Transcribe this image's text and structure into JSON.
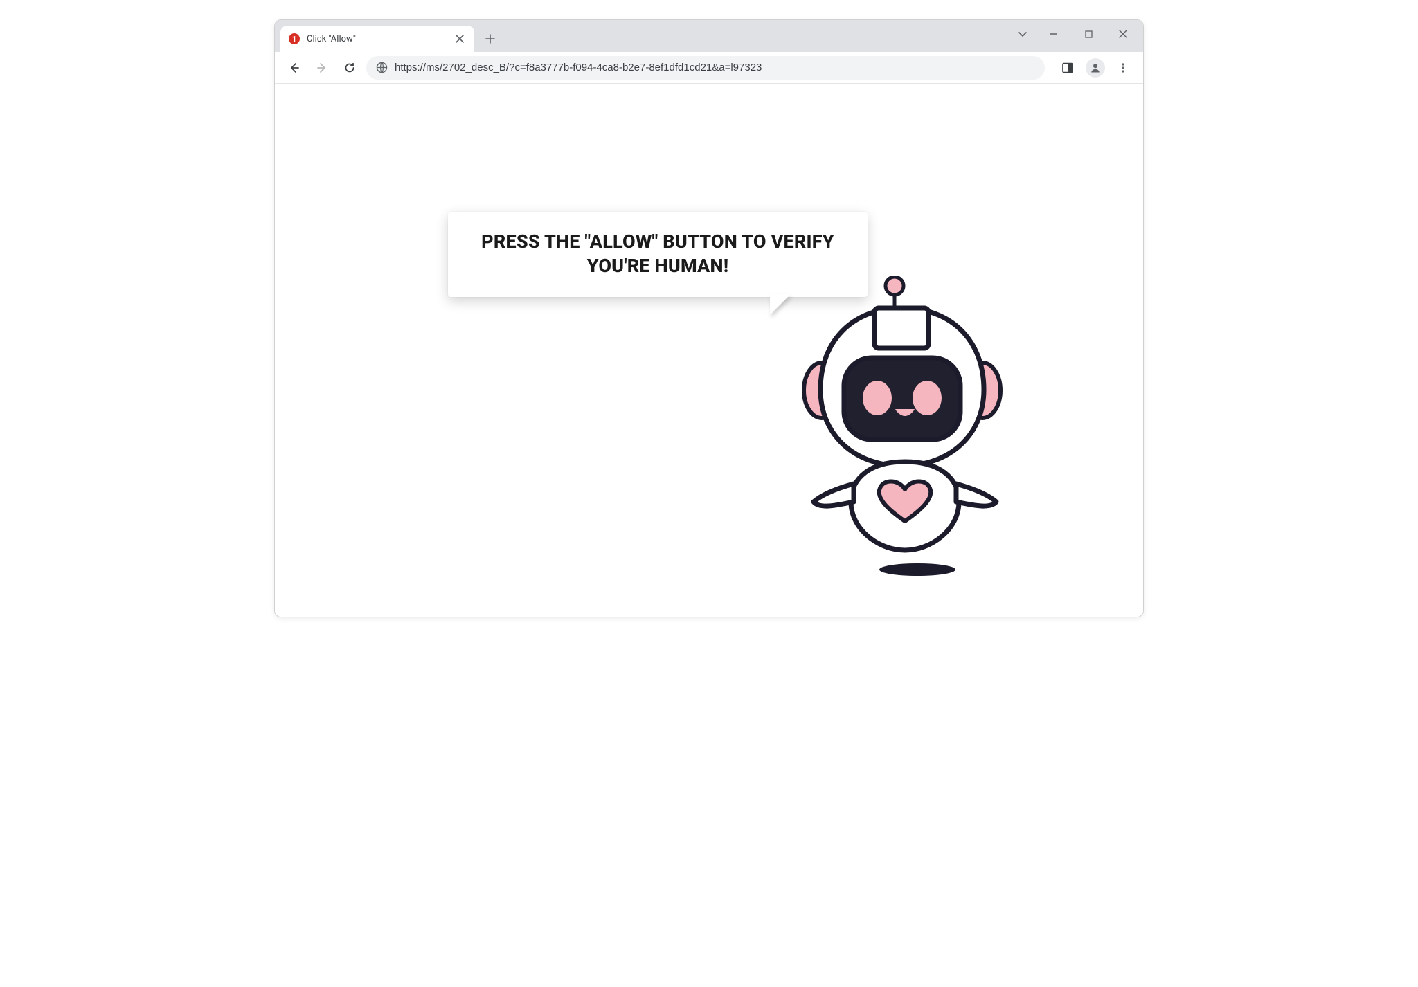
{
  "tab": {
    "badge": "1",
    "title": "Click \"Allow\""
  },
  "address_bar": {
    "url": "https://ms/2702_desc_B/?c=f8a3777b-f094-4ca8-b2e7-8ef1dfd1cd21&a=l97323"
  },
  "page": {
    "speech_text": "PRESS THE \"ALLOW\" BUTTON TO VERIFY YOU'RE HUMAN!"
  },
  "colors": {
    "robot_stroke": "#1b1b2b",
    "robot_pink": "#f5b6c0",
    "robot_face": "#20202e"
  }
}
